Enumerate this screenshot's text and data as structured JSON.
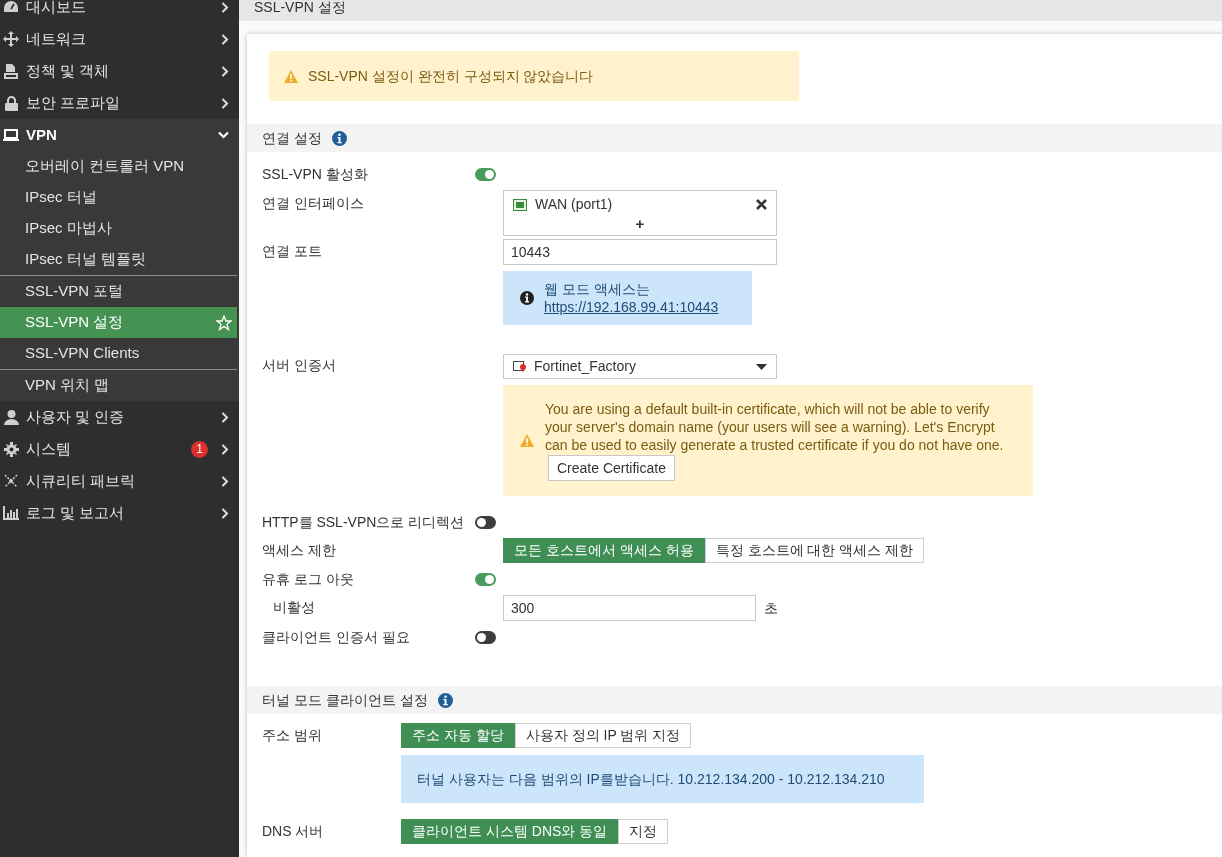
{
  "sidebar": {
    "items": [
      {
        "label": "대시보드",
        "expanded": false
      },
      {
        "label": "네트워크",
        "expanded": false
      },
      {
        "label": "정책 및 객체",
        "expanded": false
      },
      {
        "label": "보안 프로파일",
        "expanded": false
      },
      {
        "label": "VPN",
        "expanded": true,
        "children": [
          {
            "label": "오버레이 컨트롤러 VPN",
            "selected": false,
            "separator_before": false
          },
          {
            "label": "IPsec 터널",
            "selected": false,
            "separator_before": false
          },
          {
            "label": "IPsec 마법사",
            "selected": false,
            "separator_before": false
          },
          {
            "label": "IPsec 터널 템플릿",
            "selected": false,
            "separator_before": false
          },
          {
            "label": "SSL-VPN 포털",
            "selected": false,
            "separator_before": true
          },
          {
            "label": "SSL-VPN 설정",
            "selected": true,
            "separator_before": false
          },
          {
            "label": "SSL-VPN Clients",
            "selected": false,
            "separator_before": false
          },
          {
            "label": "VPN 위치 맵",
            "selected": false,
            "separator_before": true
          }
        ]
      },
      {
        "label": "사용자 및 인증",
        "expanded": false
      },
      {
        "label": "시스템",
        "expanded": false,
        "badge": "1"
      },
      {
        "label": "시큐리티 패브릭",
        "expanded": false
      },
      {
        "label": "로그 및 보고서",
        "expanded": false
      }
    ]
  },
  "page_title": "SSL-VPN 설정",
  "alert": "SSL-VPN 설정이 완전히 구성되지 않았습니다",
  "sections": [
    {
      "title": "연결 설정",
      "fields": [
        {
          "kind": "toggle",
          "label": "SSL-VPN 활성화",
          "on": true
        },
        {
          "kind": "interfaces",
          "label": "연결 인터페이스",
          "value": "WAN (port1)",
          "add": "+"
        },
        {
          "kind": "input",
          "label": "연결 포트",
          "value": "10443",
          "info": {
            "text": "웹 모드 액세스는",
            "link": "https://192.168.99.41:10443"
          }
        },
        {
          "kind": "select",
          "label": "서버 인증서",
          "value": "Fortinet_Factory",
          "warning": {
            "text": "You are using a default built-in certificate, which will not be able to verify your server's domain name (your users will see a warning). Let's Encrypt can be used to easily generate a trusted certificate if you do not have one.",
            "button": "Create Certificate"
          }
        },
        {
          "kind": "toggle",
          "label": "HTTP를 SSL-VPN으로 리디렉션",
          "on": false
        },
        {
          "kind": "segmented",
          "label": "액세스 제한",
          "options": [
            {
              "label": "모든 호스트에서 액세스 허용",
              "selected": true
            },
            {
              "label": "특정 호스트에 대한 액세스 제한",
              "selected": false
            }
          ]
        },
        {
          "kind": "toggle",
          "label": "유휴 로그 아웃",
          "on": true
        },
        {
          "kind": "sub_input",
          "label": "비활성",
          "value": "300",
          "unit": "초"
        },
        {
          "kind": "toggle",
          "label": "클라이언트 인증서 필요",
          "on": false
        }
      ]
    },
    {
      "title": "터널 모드 클라이언트 설정",
      "fields": [
        {
          "kind": "segmented",
          "label": "주소 범위",
          "options": [
            {
              "label": "주소 자동 할당",
              "selected": true
            },
            {
              "label": "사용자 정의 IP 범위 지정",
              "selected": false
            }
          ],
          "note": "터널 사용자는 다음 범위의 IP를받습니다. 10.212.134.200 - 10.212.134.210"
        },
        {
          "kind": "segmented",
          "label": "DNS 서버",
          "options": [
            {
              "label": "클라이언트 시스템 DNS와 동일",
              "selected": true
            },
            {
              "label": "지정",
              "selected": false
            }
          ]
        }
      ]
    }
  ]
}
